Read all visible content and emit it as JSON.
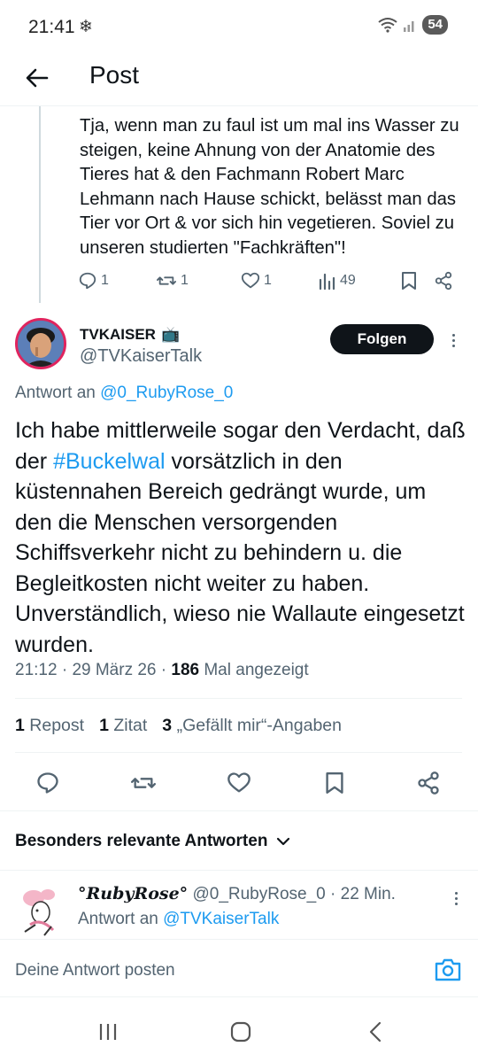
{
  "status_bar": {
    "time": "21:41",
    "weather_icon": "snowflake-icon",
    "battery": "54"
  },
  "header": {
    "title": "Post",
    "back_icon": "arrow-left-icon"
  },
  "previous_tweet": {
    "text": "Tja, wenn man zu faul ist um mal ins Wasser zu steigen, keine Ahnung von der Anatomie des Tieres hat & den Fachmann Robert Marc Lehmann nach Hause schickt, belässt man das Tier vor Ort & vor sich hin vegetieren. Soviel zu unseren studierten \"Fachkräften\"!",
    "replies": "1",
    "reposts": "1",
    "likes": "1",
    "views": "49"
  },
  "main_tweet": {
    "display_name": "TVKAISER",
    "name_emoji": "📺",
    "handle": "@TVKaiserTalk",
    "follow_label": "Folgen",
    "reply_prefix": "Antwort an ",
    "reply_handle": "@0_RubyRose_0",
    "text_before": "Ich habe mittlerweile sogar den Verdacht, daß der ",
    "hashtag": "#Buckelwal",
    "text_after": " vorsätzlich in den küstennahen Bereich gedrängt wurde, um den die Menschen versorgenden Schiffsverkehr nicht zu behindern u. die Begleitkosten nicht weiter zu haben. Unverständlich, wieso nie Wallaute eingesetzt wurden.",
    "time": "21:12",
    "date": "29 März 26",
    "views": "186",
    "views_label": "Mal angezeigt"
  },
  "stats": {
    "reposts_count": "1",
    "reposts_label": "Repost",
    "quotes_count": "1",
    "quotes_label": "Zitat",
    "likes_count": "3",
    "likes_label": "„Gefällt mir“-Angaben"
  },
  "replies_section": {
    "title": "Besonders relevante Antworten"
  },
  "reply": {
    "name": "°RubyRose°",
    "handle": "@0_RubyRose_0",
    "time": "22 Min.",
    "reply_prefix": "Antwort an ",
    "reply_handle": "@TVKaiserTalk"
  },
  "compose": {
    "placeholder": "Deine Antwort posten"
  },
  "colors": {
    "accent": "#1d9bf0",
    "text": "#0f1419",
    "secondary": "#536471"
  }
}
